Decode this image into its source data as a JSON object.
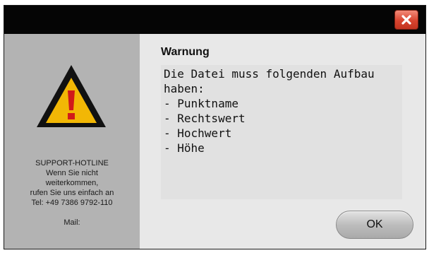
{
  "dialog": {
    "title": "Warnung",
    "message_lines": "Die Datei muss folgenden Aufbau\nhaben:\n- Punktname\n- Rechtswert\n- Hochwert\n- Höhe",
    "ok_label": "OK",
    "close_icon": "close-x-icon",
    "warning_icon": "warning-triangle-icon"
  },
  "support": {
    "heading": "SUPPORT-HOTLINE",
    "line1": "Wenn Sie nicht",
    "line2": "weiterkommen,",
    "line3": "rufen Sie uns einfach an",
    "tel": "Tel: +49 7386 9792-110",
    "mail": "Mail:"
  },
  "colors": {
    "warning_yellow": "#f2b705",
    "warning_red": "#d11a1a",
    "close_red": "#d8442f"
  }
}
